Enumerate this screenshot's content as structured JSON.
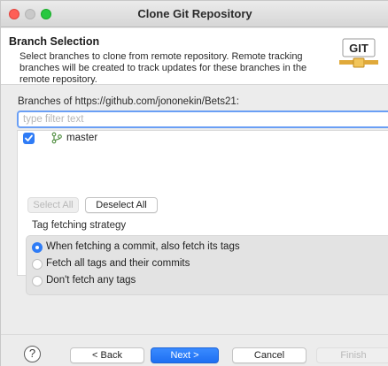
{
  "window": {
    "title": "Clone Git Repository"
  },
  "header": {
    "title": "Branch Selection",
    "description": "Select branches to clone from remote repository. Remote tracking branches will be created to track updates for these branches in the remote repository.",
    "logo_text": "GIT"
  },
  "branches": {
    "label": "Branches of https://github.com/jononekin/Bets21:",
    "filter_placeholder": "type filter text",
    "items": [
      {
        "name": "master",
        "checked": true
      }
    ],
    "select_all_label": "Select All",
    "deselect_all_label": "Deselect All"
  },
  "tag_strategy": {
    "title": "Tag fetching strategy",
    "options": [
      {
        "label": "When fetching a commit, also fetch its tags",
        "selected": true
      },
      {
        "label": "Fetch all tags and their commits",
        "selected": false
      },
      {
        "label": "Don't fetch any tags",
        "selected": false
      }
    ]
  },
  "footer": {
    "help_label": "?",
    "back_label": "< Back",
    "next_label": "Next >",
    "cancel_label": "Cancel",
    "finish_label": "Finish"
  },
  "colors": {
    "accent": "#2f7cf6",
    "close": "#fe5f57",
    "maximize": "#28c840"
  }
}
